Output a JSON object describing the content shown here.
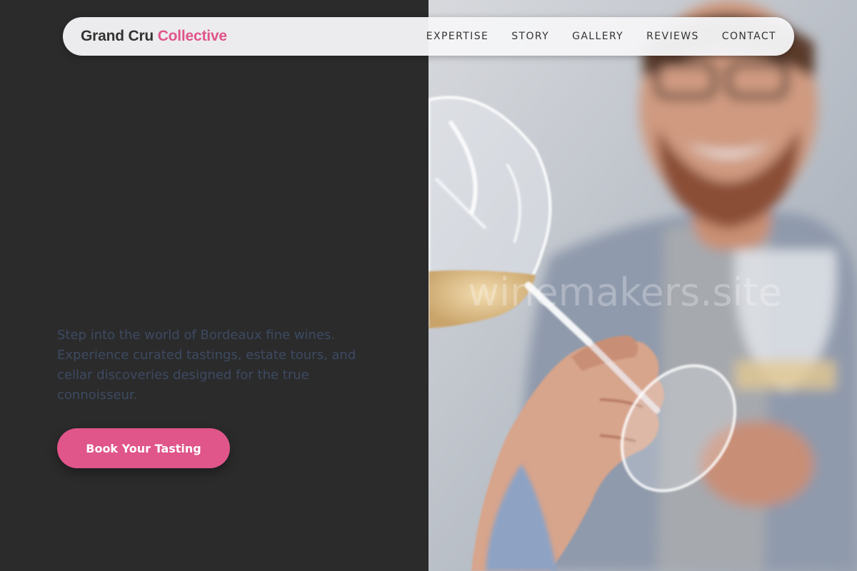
{
  "brand": {
    "name": "Grand Cru",
    "accent": "Collective",
    "accent_color": "#e0558a"
  },
  "nav": {
    "items": [
      "EXPERTISE",
      "STORY",
      "GALLERY",
      "REVIEWS",
      "CONTACT"
    ]
  },
  "hero": {
    "description": "Step into the world of Bordeaux fine wines. Experience curated tastings, estate tours, and cellar discoveries designed for the true connoisseur.",
    "cta_label": "Book Your Tasting"
  },
  "image": {
    "subject": "man-tasting-white-wine-photo",
    "watermark": "winemakers.site"
  }
}
